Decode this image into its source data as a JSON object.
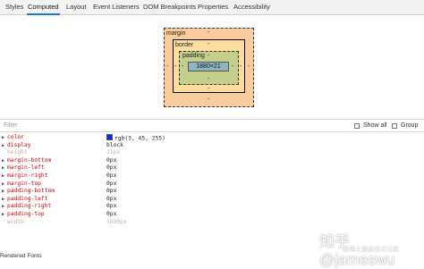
{
  "tabs": [
    {
      "label": "Styles"
    },
    {
      "label": "Computed",
      "active": true
    },
    {
      "label": "Layout"
    },
    {
      "label": "Event Listeners"
    },
    {
      "label": "DOM Breakpoints"
    },
    {
      "label": "Properties"
    },
    {
      "label": "Accessibility"
    }
  ],
  "box_model": {
    "margin_label": "margin",
    "border_label": "border",
    "padding_label": "padding",
    "content": "1880×21",
    "margin": {
      "top": "-",
      "right": "-",
      "bottom": "-",
      "left": "-"
    },
    "border": {
      "top": "-",
      "right": "-",
      "bottom": "-",
      "left": "-"
    },
    "padding": {
      "top": "-",
      "right": "-",
      "bottom": "-",
      "left": "-"
    },
    "colors": {
      "margin": "#f9cc9d",
      "border": "#fddd9b",
      "padding": "#c3cf8a",
      "content": "#8cb6c0"
    }
  },
  "filter": {
    "placeholder": "Filter",
    "show_all_label": "Show all",
    "group_label": "Group",
    "show_all_checked": false,
    "group_checked": false
  },
  "properties": [
    {
      "name": "color",
      "value": "rgb(3, 45, 255)",
      "expandable": true,
      "inherited": false,
      "swatch": "#032dff"
    },
    {
      "name": "display",
      "value": "block",
      "expandable": true,
      "inherited": false
    },
    {
      "name": "height",
      "value": "21px",
      "expandable": false,
      "inherited": true
    },
    {
      "name": "margin-bottom",
      "value": "0px",
      "expandable": true,
      "inherited": false
    },
    {
      "name": "margin-left",
      "value": "0px",
      "expandable": true,
      "inherited": false
    },
    {
      "name": "margin-right",
      "value": "0px",
      "expandable": true,
      "inherited": false
    },
    {
      "name": "margin-top",
      "value": "0px",
      "expandable": true,
      "inherited": false
    },
    {
      "name": "padding-bottom",
      "value": "0px",
      "expandable": true,
      "inherited": false
    },
    {
      "name": "padding-left",
      "value": "0px",
      "expandable": true,
      "inherited": false
    },
    {
      "name": "padding-right",
      "value": "0px",
      "expandable": true,
      "inherited": false
    },
    {
      "name": "padding-top",
      "value": "0px",
      "expandable": true,
      "inherited": false
    },
    {
      "name": "width",
      "value": "1880px",
      "expandable": false,
      "inherited": true
    }
  ],
  "section_footer": "Rendered Fonts",
  "watermark": {
    "main": "知乎 @jameswu",
    "sub": "@稀土掘金技术社区"
  }
}
